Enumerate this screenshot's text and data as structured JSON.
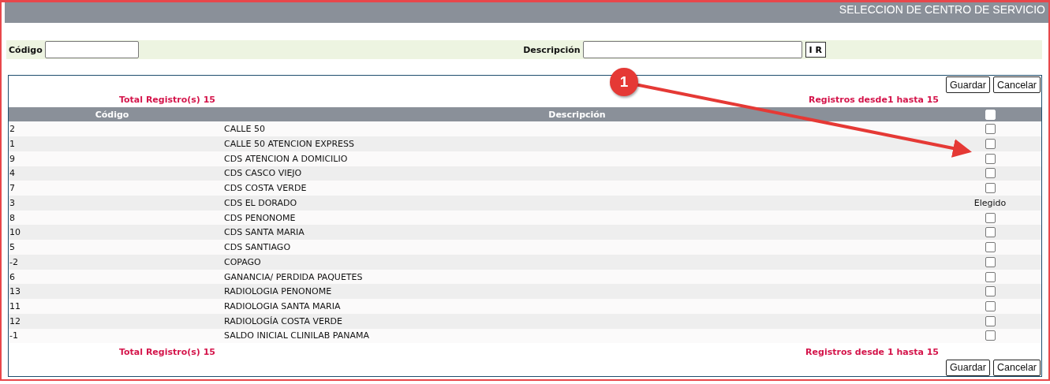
{
  "header": {
    "title": "SELECCION DE CENTRO DE SERVICIO"
  },
  "filters": {
    "code_label": "Código",
    "description_label": "Descripción",
    "go_button": "I R"
  },
  "actions_top": [
    "Guardar",
    "Cancelar"
  ],
  "summary_top": {
    "total": "Total Registro(s) 15",
    "range": "Registros desde1 hasta 15"
  },
  "table": {
    "columns": [
      "Código",
      "Descripción"
    ],
    "select_all": {
      "checked": false
    },
    "rows": [
      {
        "code": "2",
        "description": "CALLE 50",
        "kind": "checkbox",
        "checked": false
      },
      {
        "code": "1",
        "description": "CALLE 50 ATENCION EXPRESS",
        "kind": "checkbox",
        "checked": false
      },
      {
        "code": "9",
        "description": "CDS ATENCION A DOMICILIO",
        "kind": "checkbox",
        "checked": false
      },
      {
        "code": "4",
        "description": "CDS CASCO VIEJO",
        "kind": "checkbox",
        "checked": false
      },
      {
        "code": "7",
        "description": "CDS COSTA VERDE",
        "kind": "checkbox",
        "checked": false
      },
      {
        "code": "3",
        "description": "CDS EL DORADO",
        "kind": "status",
        "status": "Elegido"
      },
      {
        "code": "8",
        "description": "CDS PENONOME",
        "kind": "checkbox",
        "checked": false
      },
      {
        "code": "10",
        "description": "CDS SANTA MARIA",
        "kind": "checkbox",
        "checked": false
      },
      {
        "code": "5",
        "description": "CDS SANTIAGO",
        "kind": "checkbox",
        "checked": false
      },
      {
        "code": "-2",
        "description": "COPAGO",
        "kind": "checkbox",
        "checked": false
      },
      {
        "code": "6",
        "description": "GANANCIA/ PERDIDA PAQUETES",
        "kind": "checkbox",
        "checked": false
      },
      {
        "code": "13",
        "description": "RADIOLOGIA PENONOME",
        "kind": "checkbox",
        "checked": false
      },
      {
        "code": "11",
        "description": "RADIOLOGIA SANTA MARIA",
        "kind": "checkbox",
        "checked": false
      },
      {
        "code": "12",
        "description": "RADIOLOGÍA COSTA VERDE",
        "kind": "checkbox",
        "checked": false
      },
      {
        "code": "-1",
        "description": "SALDO INICIAL CLINILAB PANAMA",
        "kind": "checkbox",
        "checked": false
      }
    ]
  },
  "summary_bottom": {
    "total": "Total Registro(s) 15",
    "range": "Registros desde 1 hasta 15"
  },
  "actions_bottom": [
    "Guardar",
    "Cancelar"
  ],
  "annotation": {
    "badge": "1"
  }
}
